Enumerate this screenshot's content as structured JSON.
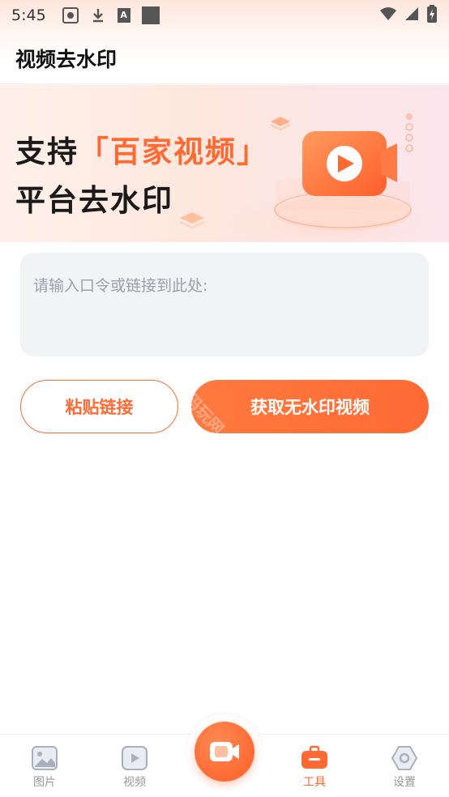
{
  "status_bar": {
    "time": "5:45",
    "left_icons": [
      "screen-record-icon",
      "download-icon",
      "font-icon",
      "square-icon"
    ],
    "right_icons": [
      "wifi-icon",
      "signal-icon",
      "battery-icon"
    ]
  },
  "header": {
    "title": "视频去水印"
  },
  "banner": {
    "line1_prefix": "支持",
    "line1_highlight": "「百家视频」",
    "line2": "平台去水印"
  },
  "input": {
    "placeholder": "请输入口令或链接到此处:",
    "value": ""
  },
  "buttons": {
    "paste_label": "粘贴链接",
    "fetch_label": "获取无水印视频"
  },
  "watermark_text": "码玩网",
  "bottom_nav": {
    "items": [
      {
        "label": "图片",
        "icon": "image-icon",
        "active": false
      },
      {
        "label": "视频",
        "icon": "video-play-icon",
        "active": false
      },
      {
        "label": "工具",
        "icon": "toolbox-icon",
        "active": true
      },
      {
        "label": "设置",
        "icon": "settings-icon",
        "active": false
      }
    ],
    "center_button_icon": "camera-record-icon"
  },
  "colors": {
    "accent": "#ff6a33",
    "inactive": "#999999",
    "input_bg": "#f2f3f5"
  }
}
